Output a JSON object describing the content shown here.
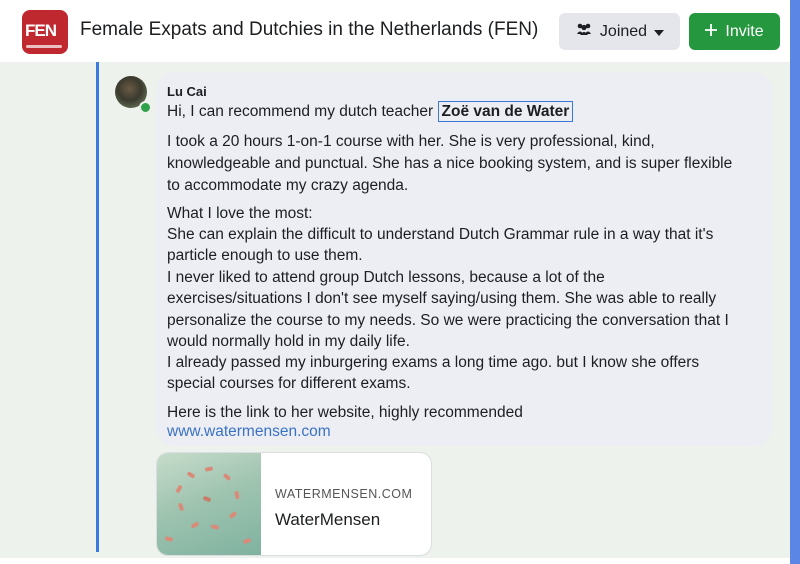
{
  "group": {
    "logo_text": "FEN",
    "title": "Female Expats and Dutchies in the Netherlands (FEN)",
    "joined_label": "Joined",
    "invite_label": "Invite"
  },
  "comment": {
    "author": "Lu Cai",
    "intro": "Hi, I can recommend my dutch teacher",
    "mention": "Zoë van de Water",
    "lines": [
      "I took a 20 hours 1-on-1 course with her. She is very professional, kind,",
      "knowledgeable and punctual. She has a nice booking system, and is super flexible",
      "to accommodate my crazy agenda.",
      "What I love the most:",
      "She can explain the difficult to understand Dutch Grammar rule in a way that it's",
      "particle enough to use them.",
      "I never liked to attend group Dutch lessons, because a lot of the",
      "exercises/situations I don't see myself saying/using them. She was able to really",
      "personalize the course to my needs. So we were practicing the conversation that I",
      "would normally hold in my daily life.",
      "I already passed my inburgering exams a long time ago. but I know she offers",
      "special courses for different exams.",
      "Here is the link to her website, highly recommended"
    ],
    "link": "www.watermensen.com"
  },
  "link_preview": {
    "domain": "WATERMENSEN.COM",
    "title": "WaterMensen"
  },
  "icons": {
    "joined": "group-icon",
    "caret": "caret-down-icon",
    "invite": "plus-icon"
  },
  "colors": {
    "invite_green": "#24973f",
    "thread_line": "#3b7be0",
    "logo_red": "#c0282f",
    "link_blue": "#3a72c4"
  }
}
